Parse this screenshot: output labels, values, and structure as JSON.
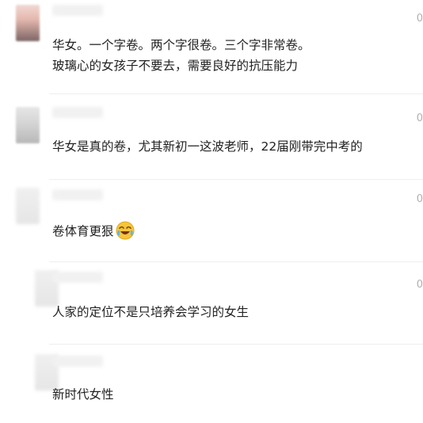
{
  "comments": [
    {
      "time": "0",
      "lines": [
        "华女。一个字卷。两个字很卷。三个字非常卷。",
        "玻璃心的女孩子不要去，需要良好的抗压能力"
      ]
    },
    {
      "time": "0",
      "lines": [
        "华女是真的卷，尤其新初一这波老师，22届刚带完中考的"
      ]
    },
    {
      "time": "0",
      "lines": [
        "卷体育更狠"
      ],
      "emoji": "laughing-crying-emoji"
    },
    {
      "time": "0",
      "lines": [
        "人家的定位不是只培养会学习的女生"
      ]
    },
    {
      "time": "",
      "lines": [
        "新时代女性"
      ]
    }
  ]
}
